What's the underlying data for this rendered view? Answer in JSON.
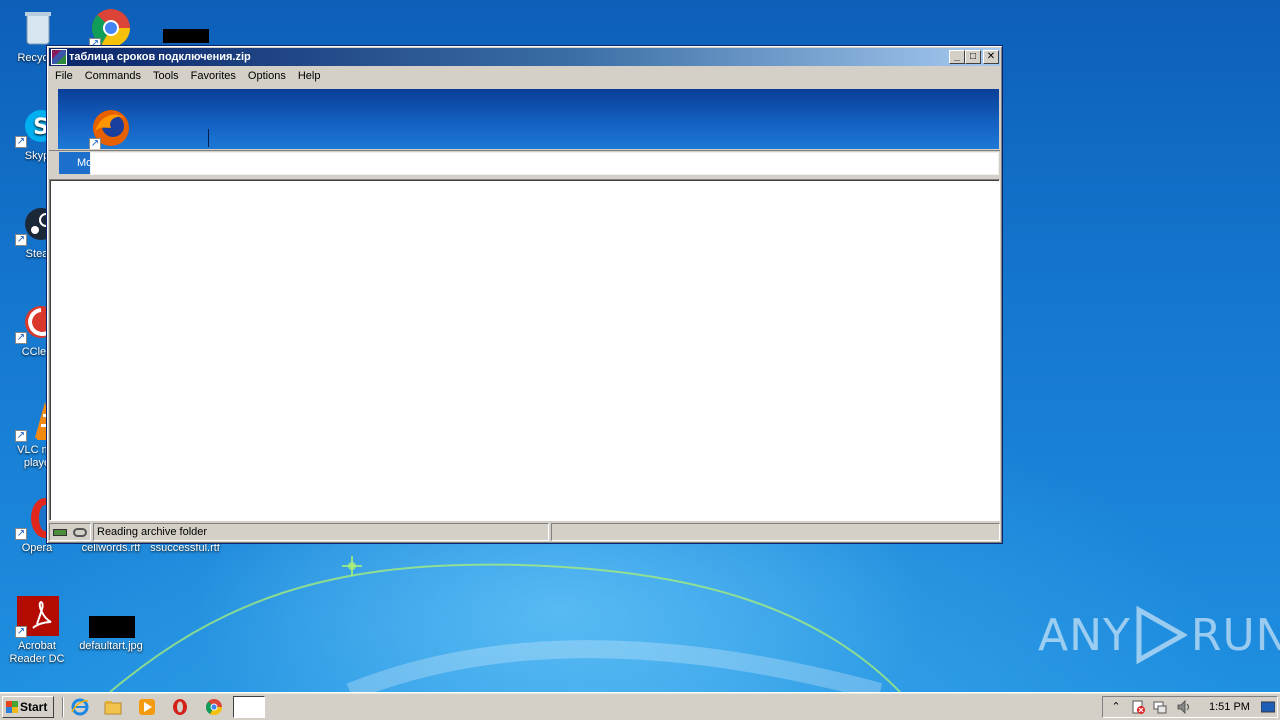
{
  "desktop": {
    "icons": [
      {
        "label": "Recycle"
      },
      {
        "label": "Skyp"
      },
      {
        "label": "Stea"
      },
      {
        "label": "CClea"
      },
      {
        "label": "VLC me\nplaye"
      },
      {
        "label": "Opera"
      },
      {
        "label": "Acrobat\nReader DC"
      },
      {
        "label": "cellwords.rtf"
      },
      {
        "label": "ssuccessful.rtf"
      },
      {
        "label": "defaultart.jpg"
      },
      {
        "label": "Mo"
      }
    ],
    "watermark": {
      "left": "ANY",
      "right": "RUN"
    }
  },
  "window": {
    "title": "таблица сроков подключения.zip",
    "caption_buttons": {
      "minimize": "_",
      "maximize": "□",
      "close": "✕"
    },
    "menu": [
      "File",
      "Commands",
      "Tools",
      "Favorites",
      "Options",
      "Help"
    ],
    "address_value": "",
    "status_text": "Reading archive folder"
  },
  "taskbar": {
    "start_label": "Start",
    "clock": "1:51 PM"
  },
  "colors": {
    "title_gradient_start": "#0a246a",
    "title_gradient_end": "#a6caf0",
    "classic_face": "#d4d0c8",
    "desktop_blue": "#1a74c9"
  }
}
